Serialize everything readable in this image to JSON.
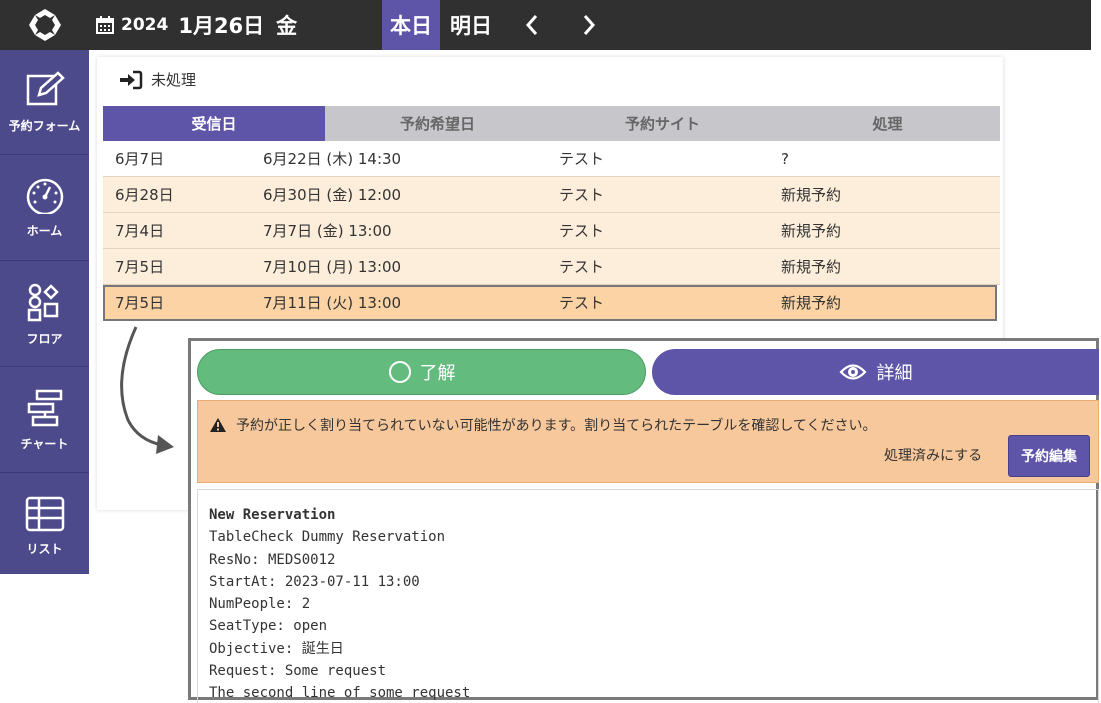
{
  "header": {
    "year": "2024",
    "month_day": "1月26日",
    "weekday": "金",
    "today_label": "本日",
    "tomorrow_label": "明日"
  },
  "sidebar": {
    "items": [
      {
        "label": "予約フォーム",
        "icon": "edit-icon"
      },
      {
        "label": "ホーム",
        "icon": "dashboard-icon"
      },
      {
        "label": "フロア",
        "icon": "floor-icon"
      },
      {
        "label": "チャート",
        "icon": "chart-icon"
      },
      {
        "label": "リスト",
        "icon": "list-icon"
      }
    ]
  },
  "panel": {
    "title": "未処理",
    "columns": [
      "受信日",
      "予約希望日",
      "予約サイト",
      "処理"
    ],
    "rows": [
      {
        "received": "6月7日",
        "requested": "6月22日 (木) 14:30",
        "site": "テスト",
        "action": "?"
      },
      {
        "received": "6月28日",
        "requested": "6月30日 (金) 12:00",
        "site": "テスト",
        "action": "新規予約"
      },
      {
        "received": "7月4日",
        "requested": "7月7日 (金) 13:00",
        "site": "テスト",
        "action": "新規予約"
      },
      {
        "received": "7月5日",
        "requested": "7月10日 (月) 13:00",
        "site": "テスト",
        "action": "新規予約"
      },
      {
        "received": "7月5日",
        "requested": "7月11日 (火) 13:00",
        "site": "テスト",
        "action": "新規予約"
      }
    ]
  },
  "detail": {
    "ok_label": "了解",
    "detail_label": "詳細",
    "warning": "予約が正しく割り当てられていない可能性があります。割り当てられたテーブルを確認してください。",
    "mark_done": "処理済みにする",
    "edit_label": "予約編集",
    "raw_lines": [
      "New Reservation",
      "TableCheck Dummy Reservation",
      "ResNo: MEDS0012",
      "StartAt: 2023-07-11 13:00",
      "NumPeople: 2",
      "SeatType: open",
      "Objective: 誕生日",
      "Request: Some request",
      "The second line of some request"
    ]
  },
  "colors": {
    "topbar": "#303030",
    "accent": "#5f55a8",
    "sidebar": "#4d4a8c",
    "ok_green": "#63bb7d",
    "warning_bg": "#f7c89b",
    "row_cream": "#fdeedb",
    "row_selected": "#fbd3a5"
  }
}
